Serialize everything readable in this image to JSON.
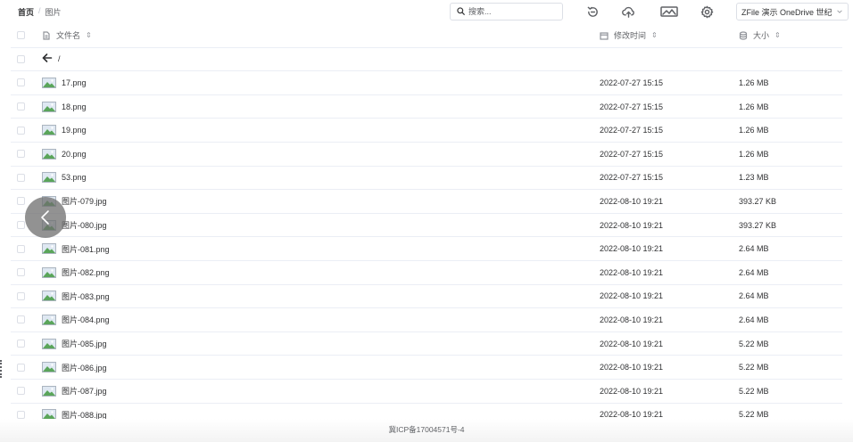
{
  "breadcrumb": {
    "home": "首页",
    "separator": "/",
    "current": "图片"
  },
  "search": {
    "placeholder": "搜索..."
  },
  "drive_select": {
    "value": "ZFile 演示 OneDrive 世纪"
  },
  "table": {
    "headers": {
      "name": "文件名",
      "time": "修改时间",
      "size": "大小",
      "sort_glyph": "⇕"
    },
    "parent_row": {
      "label": "/"
    },
    "rows": [
      {
        "name": "17.png",
        "time": "2022-07-27 15:15",
        "size": "1.26 MB"
      },
      {
        "name": "18.png",
        "time": "2022-07-27 15:15",
        "size": "1.26 MB"
      },
      {
        "name": "19.png",
        "time": "2022-07-27 15:15",
        "size": "1.26 MB"
      },
      {
        "name": "20.png",
        "time": "2022-07-27 15:15",
        "size": "1.26 MB"
      },
      {
        "name": "53.png",
        "time": "2022-07-27 15:15",
        "size": "1.23 MB"
      },
      {
        "name": "图片-079.jpg",
        "time": "2022-08-10 19:21",
        "size": "393.27 KB"
      },
      {
        "name": "图片-080.jpg",
        "time": "2022-08-10 19:21",
        "size": "393.27 KB"
      },
      {
        "name": "图片-081.png",
        "time": "2022-08-10 19:21",
        "size": "2.64 MB"
      },
      {
        "name": "图片-082.png",
        "time": "2022-08-10 19:21",
        "size": "2.64 MB"
      },
      {
        "name": "图片-083.png",
        "time": "2022-08-10 19:21",
        "size": "2.64 MB"
      },
      {
        "name": "图片-084.png",
        "time": "2022-08-10 19:21",
        "size": "2.64 MB"
      },
      {
        "name": "图片-085.jpg",
        "time": "2022-08-10 19:21",
        "size": "5.22 MB"
      },
      {
        "name": "图片-086.jpg",
        "time": "2022-08-10 19:21",
        "size": "5.22 MB"
      },
      {
        "name": "图片-087.jpg",
        "time": "2022-08-10 19:21",
        "size": "5.22 MB"
      },
      {
        "name": "图片-088.jpg",
        "time": "2022-08-10 19:21",
        "size": "5.22 MB"
      }
    ]
  },
  "footer": {
    "text": "冀ICP备17004571号-4"
  },
  "icons": {
    "search": "search-icon",
    "refresh": "refresh-icon",
    "upload": "cloud-upload-icon",
    "gallery": "gallery-icon",
    "settings": "gear-icon",
    "file": "file-icon",
    "calendar": "calendar-icon",
    "size": "database-icon",
    "back": "arrow-left-icon",
    "image": "image-file-icon"
  },
  "colors": {
    "image_thumb_sky": "#dfe8f2",
    "image_thumb_hill": "#5aa55a",
    "border": "#ebeef5"
  }
}
